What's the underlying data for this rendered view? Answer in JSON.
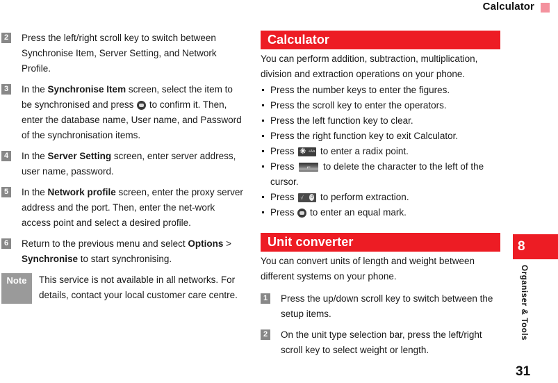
{
  "header": {
    "title": "Calculator",
    "mark_color": "#f4929e"
  },
  "theme": {
    "accent_red": "#ed1c24",
    "step_gray": "#888888",
    "note_gray": "#9a9a9a"
  },
  "left_column": {
    "steps": [
      {
        "num": "2",
        "text_runs": [
          {
            "text": "Press the left/right scroll key to switch between Synchronise Item, Server Setting, and Network Profile.",
            "bold": false
          }
        ]
      },
      {
        "num": "3",
        "text_runs": [
          {
            "text": "In the ",
            "bold": false
          },
          {
            "text": "Synchronise Item",
            "bold": true
          },
          {
            "text": " screen, select the item to be synchronised and press ",
            "bold": false
          },
          {
            "icon": "ok-key"
          },
          {
            "text": " to confirm it. Then, enter the database name, User name, and Password of the synchronisation items.",
            "bold": false
          }
        ]
      },
      {
        "num": "4",
        "text_runs": [
          {
            "text": "In the ",
            "bold": false
          },
          {
            "text": "Server Setting",
            "bold": true
          },
          {
            "text": " screen, enter server address, user name, password.",
            "bold": false
          }
        ]
      },
      {
        "num": "5",
        "text_runs": [
          {
            "text": "In the ",
            "bold": false
          },
          {
            "text": "Network profile",
            "bold": true
          },
          {
            "text": " screen, enter the proxy server address and the port. Then, enter the net-work access point and select a desired profile.",
            "bold": false
          }
        ]
      },
      {
        "num": "6",
        "text_runs": [
          {
            "text": "Return to the previous menu and select ",
            "bold": false
          },
          {
            "text": "Options",
            "bold": true
          },
          {
            "text": " > ",
            "bold": false
          },
          {
            "text": "Synchronise",
            "bold": true
          },
          {
            "text": " to start synchronising.",
            "bold": false
          }
        ]
      }
    ],
    "note": {
      "label": "Note",
      "text": "This service is not available in all networks. For details, contact your local customer care centre."
    }
  },
  "right_column": {
    "sections": [
      {
        "banner": "Calculator",
        "intro": "You can perform addition, subtraction, multiplication, division and extraction operations on your phone.",
        "bullets": [
          {
            "runs": [
              {
                "text": "Press the number keys to enter the figures.",
                "bold": false
              }
            ]
          },
          {
            "runs": [
              {
                "text": "Press the scroll key to enter the operators.",
                "bold": false
              }
            ]
          },
          {
            "runs": [
              {
                "text": "Press the left function key to clear.",
                "bold": false
              }
            ]
          },
          {
            "runs": [
              {
                "text": "Press the right function key to exit Calculator.",
                "bold": false
              }
            ]
          },
          {
            "runs": [
              {
                "text": "Press ",
                "bold": false
              },
              {
                "icon": "star-key"
              },
              {
                "text": " to enter a radix point.",
                "bold": false
              }
            ]
          },
          {
            "runs": [
              {
                "text": "Press ",
                "bold": false
              },
              {
                "icon": "clear-key"
              },
              {
                "text": " to delete the character to the left of the cursor.",
                "bold": false
              }
            ]
          },
          {
            "runs": [
              {
                "text": "Press ",
                "bold": false
              },
              {
                "icon": "sqrt-key"
              },
              {
                "text": " to perform extraction.",
                "bold": false
              }
            ]
          },
          {
            "runs": [
              {
                "text": "Press ",
                "bold": false
              },
              {
                "icon": "ok-key"
              },
              {
                "text": " to enter an equal mark.",
                "bold": false
              }
            ]
          }
        ]
      },
      {
        "banner": "Unit converter",
        "intro": "You can convert units of length and weight between different systems on your phone.",
        "steps": [
          {
            "num": "1",
            "runs": [
              {
                "text": "Press the up/down scroll key to switch between the setup items.",
                "bold": false
              }
            ]
          },
          {
            "num": "2",
            "runs": [
              {
                "text": "On the unit type selection bar, press the left/right scroll key to select weight or length.",
                "bold": false
              }
            ]
          }
        ]
      }
    ]
  },
  "side_tab": {
    "chapter": "8",
    "label": "Organiser & Tools"
  },
  "footer": {
    "page_number": "31"
  },
  "icon_glyphs": {
    "star_key_main": "✳",
    "star_key_sub": "+A/a",
    "clear_key": "⌐",
    "sqrt_key_left": "√",
    "sqrt_key_right": "0",
    "ok_key": ""
  }
}
